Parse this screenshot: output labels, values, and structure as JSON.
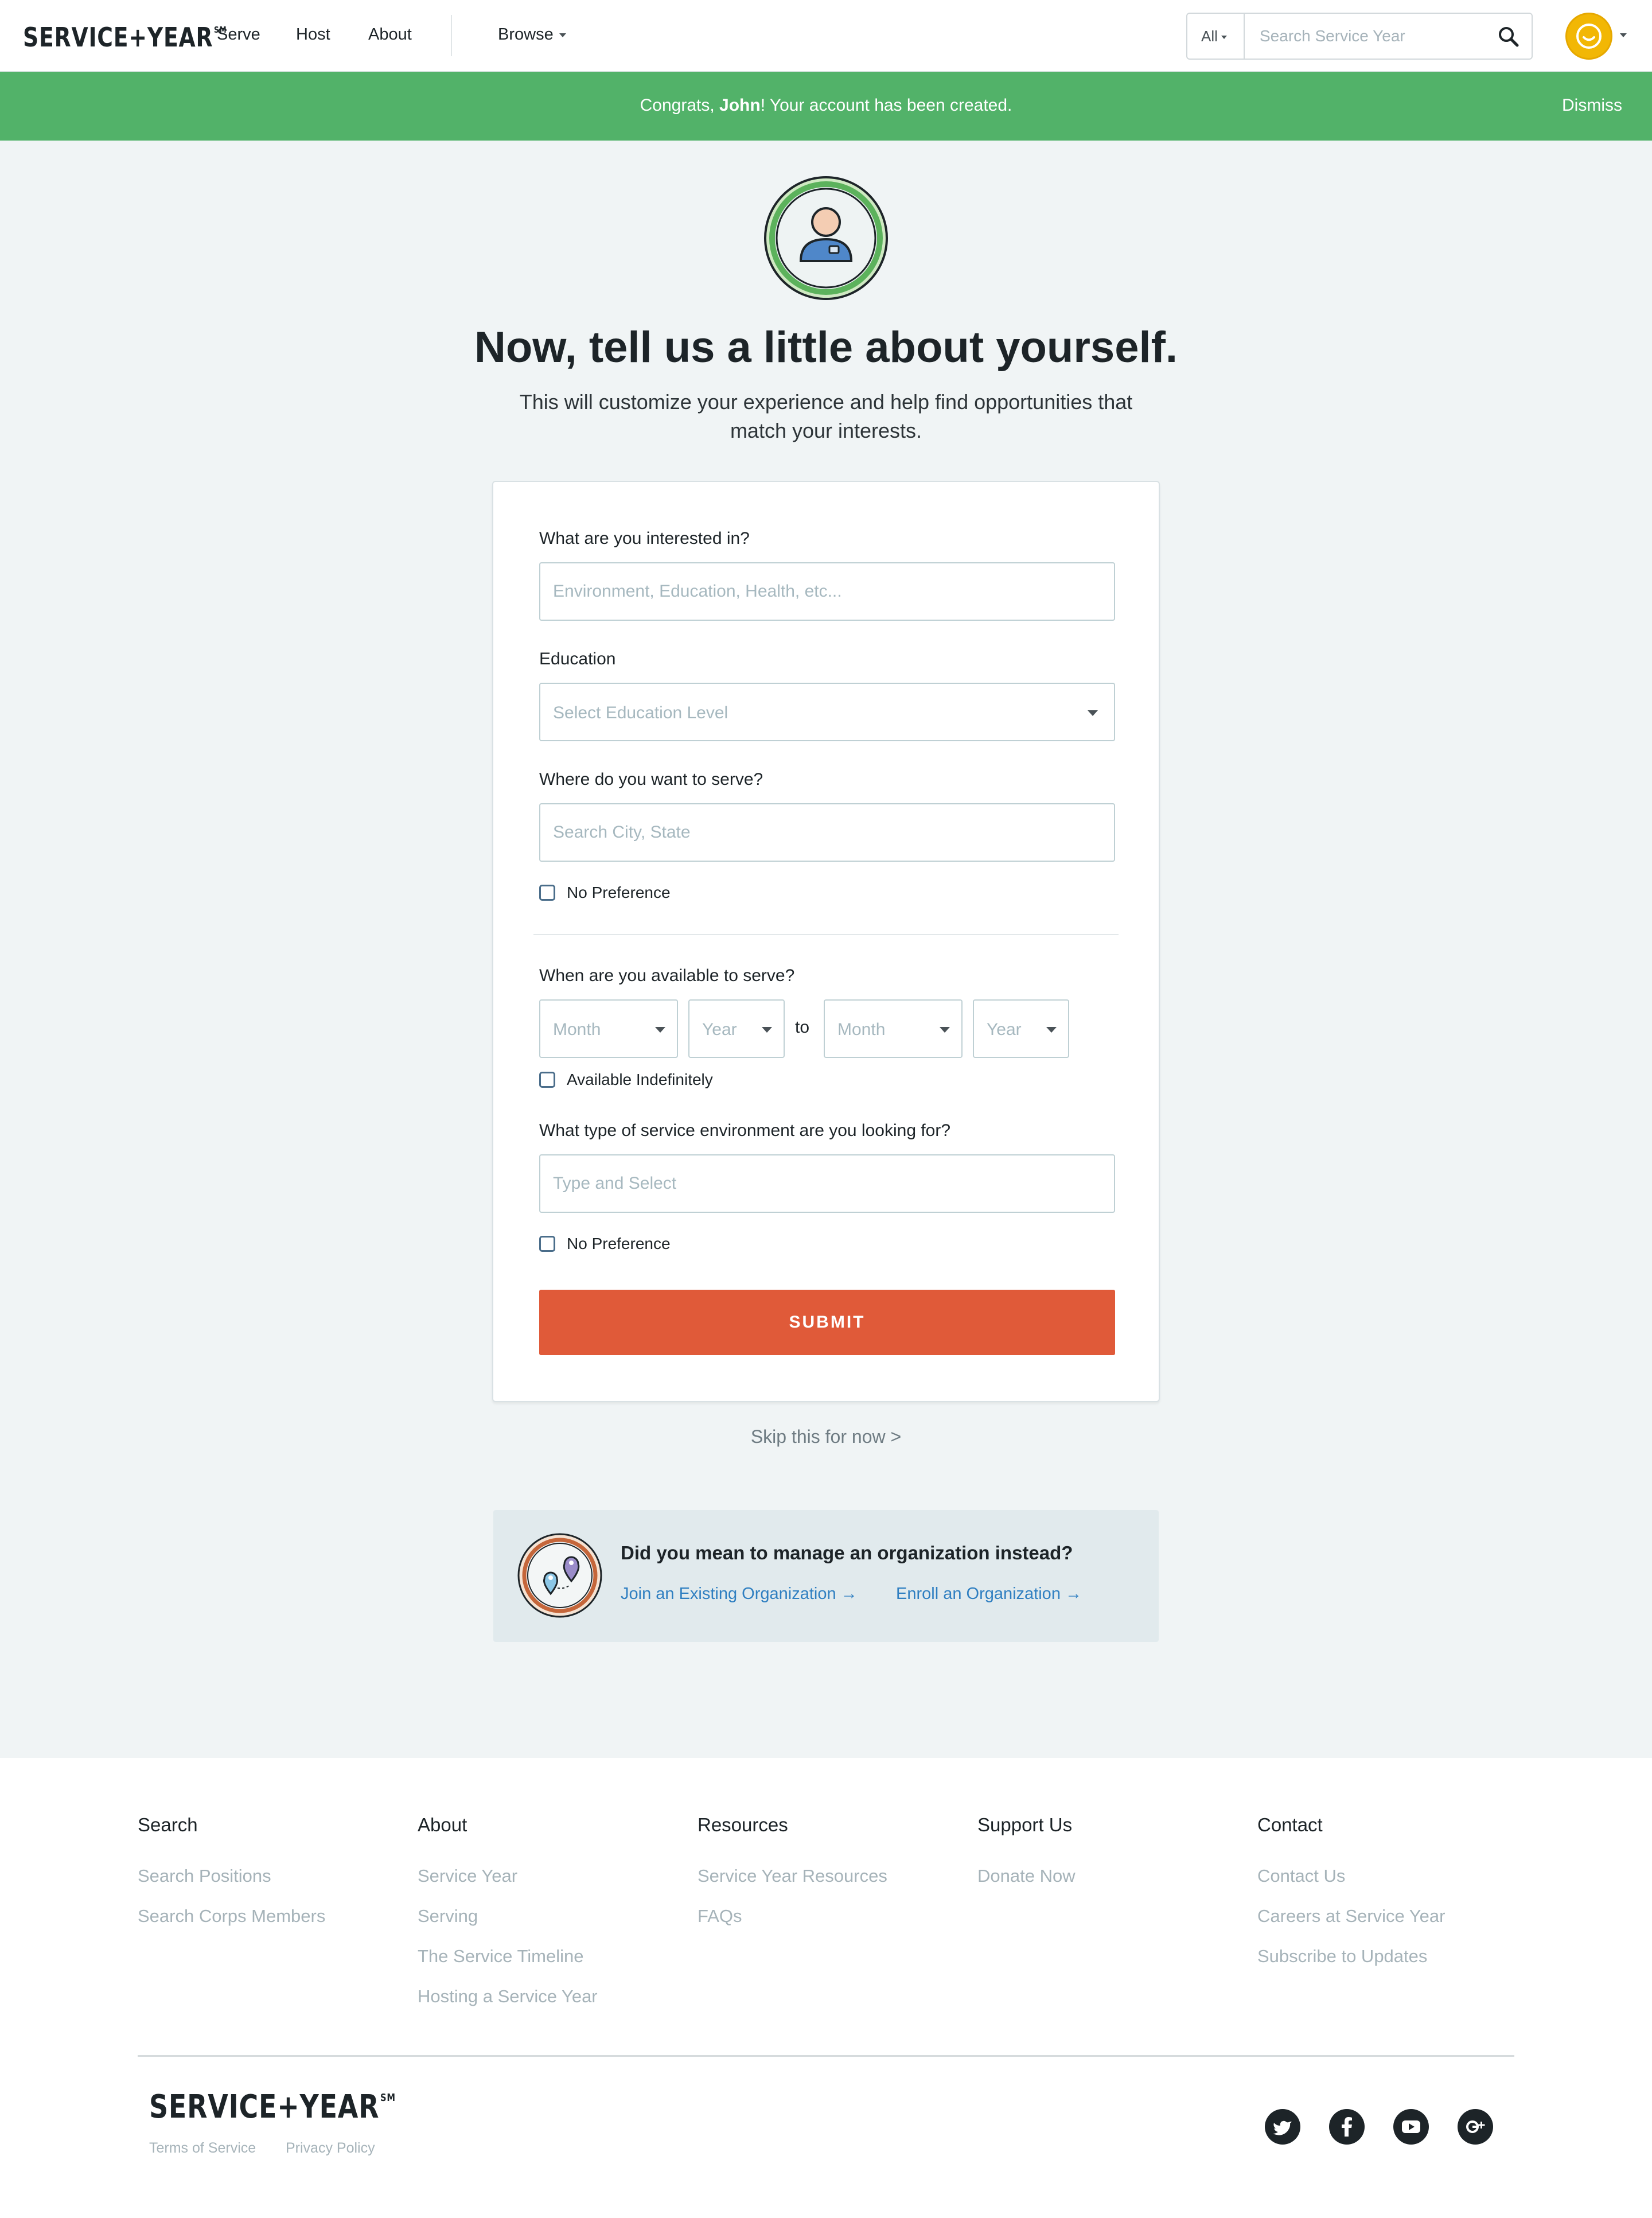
{
  "header": {
    "logo": "SERVICE+YEAR",
    "logo_mark": "SM",
    "nav": [
      "Serve",
      "Host",
      "About"
    ],
    "browse_label": "Browse",
    "search_scope": "All",
    "search_placeholder": "Search Service Year",
    "icons": [
      "search-icon",
      "user-avatar",
      "chevron-down-icon"
    ],
    "avatar_color": "#f2b705"
  },
  "banner": {
    "prefix": "Congrats, ",
    "name": "John",
    "suffix": "! Your account has been created.",
    "dismiss_label": "Dismiss",
    "color": "#52b269"
  },
  "hero": {
    "title": "Now, tell us a little about yourself.",
    "subtitle": "This will customize your experience and help find opportunities that match your interests."
  },
  "form": {
    "interests_label": "What are you interested in?",
    "interests_placeholder": "Environment, Education, Health, etc...",
    "education_label": "Education",
    "education_placeholder": "Select Education Level",
    "location_label": "Where do you want to serve?",
    "location_placeholder": "Search City, State",
    "location_no_pref": "No Preference",
    "availability_label": "When are you available to serve?",
    "start_month": "Month",
    "start_year": "Year",
    "to_label": "to",
    "end_month": "Month",
    "end_year": "Year",
    "available_indefinitely": "Available Indefinitely",
    "environment_label": "What type of service environment are you looking for?",
    "environment_placeholder": "Type and Select",
    "environment_no_pref": "No Preference",
    "submit_label": "SUBMIT",
    "submit_color": "#e05a39"
  },
  "skip_label": "Skip this for now >",
  "org": {
    "title": "Did you mean to manage an organization instead?",
    "join_label": "Join an Existing Organization →",
    "enroll_label": "Enroll an Organization →",
    "link_color": "#2f7fc1"
  },
  "footer": {
    "columns": [
      {
        "heading": "Search",
        "links": [
          "Search Positions",
          "Search Corps Members"
        ]
      },
      {
        "heading": "About",
        "links": [
          "Service Year",
          "Serving",
          "The Service Timeline",
          "Hosting a Service Year"
        ]
      },
      {
        "heading": "Resources",
        "links": [
          "Service Year Resources",
          "FAQs"
        ]
      },
      {
        "heading": "Support Us",
        "links": [
          "Donate Now"
        ]
      },
      {
        "heading": "Contact",
        "links": [
          "Contact Us",
          "Careers at Service Year",
          "Subscribe to Updates"
        ]
      }
    ],
    "logo": "SERVICE+YEAR",
    "logo_mark": "SM",
    "terms_label": "Terms of Service",
    "privacy_label": "Privacy Policy",
    "social_icons": [
      "twitter-icon",
      "facebook-icon",
      "youtube-icon",
      "google-plus-icon"
    ]
  }
}
